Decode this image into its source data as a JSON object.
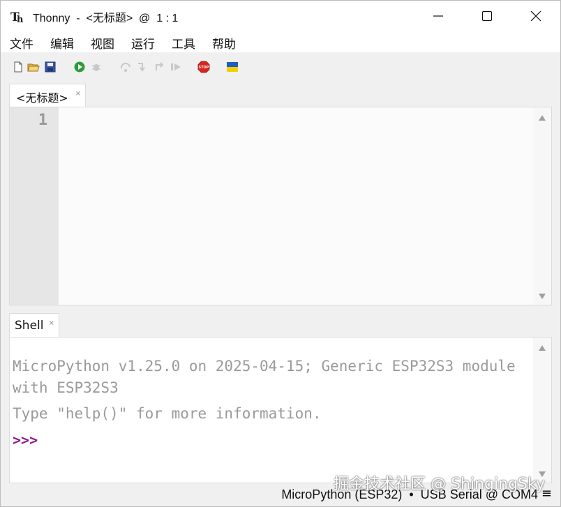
{
  "window": {
    "title": "Thonny  -  <无标题>  @  1 : 1"
  },
  "menu": {
    "items": [
      "文件",
      "编辑",
      "视图",
      "运行",
      "工具",
      "帮助"
    ]
  },
  "toolbar": {
    "icons": [
      "new-file-icon",
      "open-file-icon",
      "save-icon",
      "run-icon",
      "debug-icon",
      "step-over-icon",
      "step-into-icon",
      "step-out-icon",
      "resume-icon",
      "stop-icon",
      "ukraine-flag-icon"
    ]
  },
  "editor": {
    "tab_label": "<无标题>",
    "tab_close": "×",
    "line_numbers": [
      "1"
    ]
  },
  "shell": {
    "tab_label": "Shell",
    "tab_close": "×",
    "banner": "MicroPython v1.25.0 on 2025-04-15; Generic ESP32S3 module with ESP32S3",
    "help_line": "Type \"help()\" for more information.",
    "prompt": ">>>"
  },
  "status": {
    "text": "MicroPython (ESP32)  •  USB Serial @ COM4",
    "menu_glyph": "≡"
  },
  "watermark": "掘金技术社区 @ ShingingSky",
  "colors": {
    "prompt": "#8a1c8a",
    "shell_text": "#9a9a9a",
    "gutter": "#e6e6e6"
  }
}
